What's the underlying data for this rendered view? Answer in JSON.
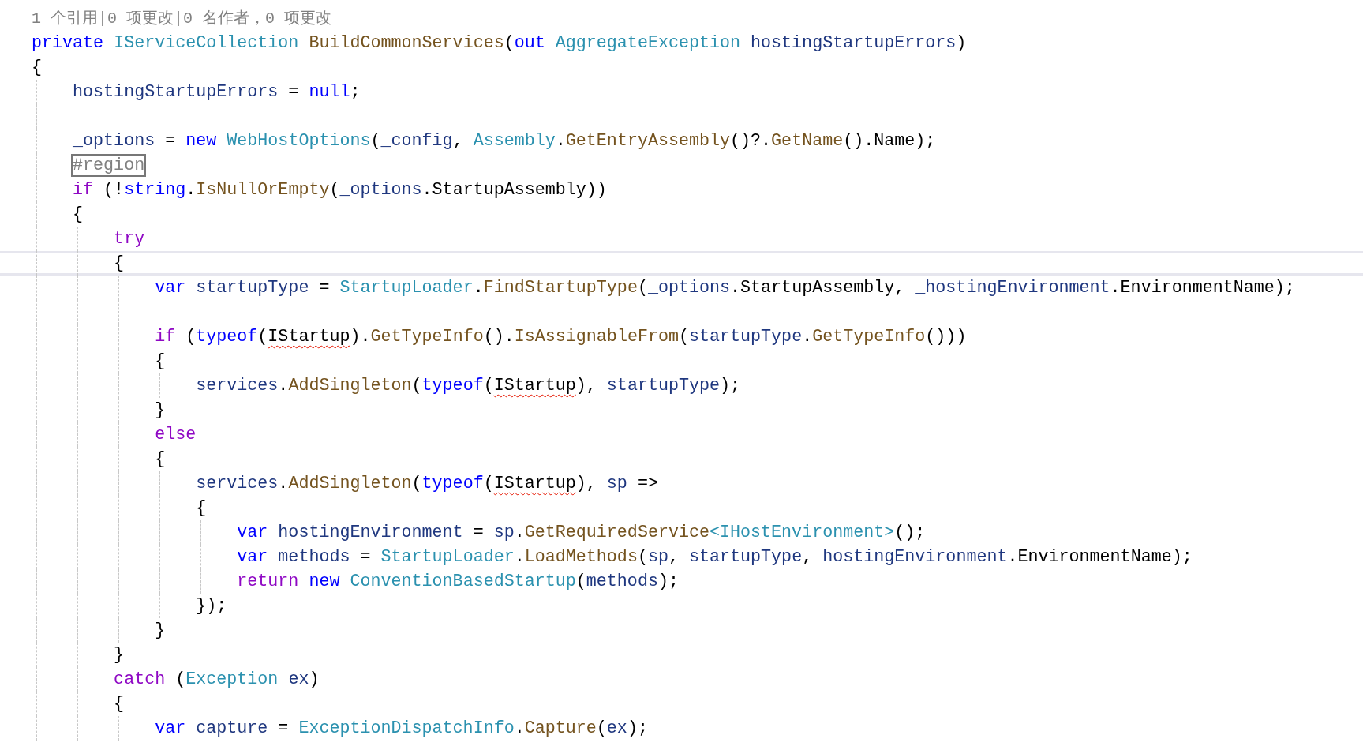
{
  "editor": {
    "lines": [
      {
        "kind": "codelens",
        "current": false,
        "tokens": [
          {
            "kind": "comment",
            "text": "1 个引用|0 项更改|0 名作者，0 项更改"
          }
        ]
      },
      {
        "kind": "code",
        "current": false,
        "tokens": [
          {
            "kind": "keyword",
            "text": "private "
          },
          {
            "kind": "type",
            "text": "IServiceCollection "
          },
          {
            "kind": "method",
            "text": "BuildCommonServices"
          },
          {
            "kind": "punct",
            "text": "("
          },
          {
            "kind": "keyword",
            "text": "out "
          },
          {
            "kind": "type",
            "text": "AggregateException "
          },
          {
            "kind": "variable",
            "text": "hostingStartupErrors"
          },
          {
            "kind": "punct",
            "text": ")"
          }
        ]
      },
      {
        "kind": "code",
        "current": false,
        "tokens": [
          {
            "kind": "punct",
            "text": "{"
          }
        ]
      },
      {
        "kind": "code",
        "current": false,
        "tokens": [
          {
            "kind": "variable",
            "text": "    hostingStartupErrors"
          },
          {
            "kind": "punct",
            "text": " = "
          },
          {
            "kind": "keyword",
            "text": "null"
          },
          {
            "kind": "punct",
            "text": ";"
          }
        ]
      },
      {
        "kind": "blank",
        "current": false
      },
      {
        "kind": "code",
        "current": false,
        "tokens": [
          {
            "kind": "variable",
            "text": "    _options"
          },
          {
            "kind": "punct",
            "text": " = "
          },
          {
            "kind": "keyword",
            "text": "new "
          },
          {
            "kind": "type",
            "text": "WebHostOptions"
          },
          {
            "kind": "punct",
            "text": "("
          },
          {
            "kind": "variable",
            "text": "_config"
          },
          {
            "kind": "punct",
            "text": ", "
          },
          {
            "kind": "type",
            "text": "Assembly"
          },
          {
            "kind": "punct",
            "text": "."
          },
          {
            "kind": "method",
            "text": "GetEntryAssembly"
          },
          {
            "kind": "punct",
            "text": "()?."
          },
          {
            "kind": "method",
            "text": "GetName"
          },
          {
            "kind": "punct",
            "text": "().Name);"
          }
        ]
      },
      {
        "kind": "code",
        "current": false,
        "tokens": [
          {
            "kind": "region",
            "text": "    #region"
          }
        ]
      },
      {
        "kind": "code",
        "current": false,
        "tokens": [
          {
            "kind": "control",
            "text": "    if "
          },
          {
            "kind": "punct",
            "text": "(!"
          },
          {
            "kind": "keyword",
            "text": "string"
          },
          {
            "kind": "punct",
            "text": "."
          },
          {
            "kind": "method",
            "text": "IsNullOrEmpty"
          },
          {
            "kind": "punct",
            "text": "("
          },
          {
            "kind": "variable",
            "text": "_options"
          },
          {
            "kind": "punct",
            "text": ".StartupAssembly))"
          }
        ]
      },
      {
        "kind": "code",
        "current": false,
        "tokens": [
          {
            "kind": "punct",
            "text": "    {"
          }
        ]
      },
      {
        "kind": "code",
        "current": false,
        "tokens": [
          {
            "kind": "control",
            "text": "        try"
          }
        ]
      },
      {
        "kind": "code",
        "current": true,
        "tokens": [
          {
            "kind": "punct",
            "text": "        {"
          }
        ]
      },
      {
        "kind": "code",
        "current": false,
        "tokens": [
          {
            "kind": "keyword",
            "text": "            var "
          },
          {
            "kind": "variable",
            "text": "startupType"
          },
          {
            "kind": "punct",
            "text": " = "
          },
          {
            "kind": "type",
            "text": "StartupLoader"
          },
          {
            "kind": "punct",
            "text": "."
          },
          {
            "kind": "method",
            "text": "FindStartupType"
          },
          {
            "kind": "punct",
            "text": "("
          },
          {
            "kind": "variable",
            "text": "_options"
          },
          {
            "kind": "punct",
            "text": ".StartupAssembly, "
          },
          {
            "kind": "variable",
            "text": "_hostingEnvironment"
          },
          {
            "kind": "punct",
            "text": ".EnvironmentName);"
          }
        ]
      },
      {
        "kind": "blank",
        "current": false
      },
      {
        "kind": "code",
        "current": false,
        "tokens": [
          {
            "kind": "control",
            "text": "            if "
          },
          {
            "kind": "punct",
            "text": "("
          },
          {
            "kind": "keyword",
            "text": "typeof"
          },
          {
            "kind": "punct",
            "text": "("
          },
          {
            "kind": "error_type",
            "text": "IStartup"
          },
          {
            "kind": "punct",
            "text": ")."
          },
          {
            "kind": "method",
            "text": "GetTypeInfo"
          },
          {
            "kind": "punct",
            "text": "()."
          },
          {
            "kind": "method",
            "text": "IsAssignableFrom"
          },
          {
            "kind": "punct",
            "text": "("
          },
          {
            "kind": "variable",
            "text": "startupType"
          },
          {
            "kind": "punct",
            "text": "."
          },
          {
            "kind": "method",
            "text": "GetTypeInfo"
          },
          {
            "kind": "punct",
            "text": "()))"
          }
        ]
      },
      {
        "kind": "code",
        "current": false,
        "tokens": [
          {
            "kind": "punct",
            "text": "            {"
          }
        ]
      },
      {
        "kind": "code",
        "current": false,
        "tokens": [
          {
            "kind": "variable",
            "text": "                services"
          },
          {
            "kind": "punct",
            "text": "."
          },
          {
            "kind": "method",
            "text": "AddSingleton"
          },
          {
            "kind": "punct",
            "text": "("
          },
          {
            "kind": "keyword",
            "text": "typeof"
          },
          {
            "kind": "punct",
            "text": "("
          },
          {
            "kind": "error_type",
            "text": "IStartup"
          },
          {
            "kind": "punct",
            "text": "), "
          },
          {
            "kind": "variable",
            "text": "startupType"
          },
          {
            "kind": "punct",
            "text": ");"
          }
        ]
      },
      {
        "kind": "code",
        "current": false,
        "tokens": [
          {
            "kind": "punct",
            "text": "            }"
          }
        ]
      },
      {
        "kind": "code",
        "current": false,
        "tokens": [
          {
            "kind": "control",
            "text": "            else"
          }
        ]
      },
      {
        "kind": "code",
        "current": false,
        "tokens": [
          {
            "kind": "punct",
            "text": "            {"
          }
        ]
      },
      {
        "kind": "code",
        "current": false,
        "tokens": [
          {
            "kind": "variable",
            "text": "                services"
          },
          {
            "kind": "punct",
            "text": "."
          },
          {
            "kind": "method",
            "text": "AddSingleton"
          },
          {
            "kind": "punct",
            "text": "("
          },
          {
            "kind": "keyword",
            "text": "typeof"
          },
          {
            "kind": "punct",
            "text": "("
          },
          {
            "kind": "error_type",
            "text": "IStartup"
          },
          {
            "kind": "punct",
            "text": "), "
          },
          {
            "kind": "variable",
            "text": "sp"
          },
          {
            "kind": "punct",
            "text": " =>"
          }
        ]
      },
      {
        "kind": "code",
        "current": false,
        "tokens": [
          {
            "kind": "punct",
            "text": "                {"
          }
        ]
      },
      {
        "kind": "code",
        "current": false,
        "tokens": [
          {
            "kind": "keyword",
            "text": "                    var "
          },
          {
            "kind": "variable",
            "text": "hostingEnvironment"
          },
          {
            "kind": "punct",
            "text": " = "
          },
          {
            "kind": "variable",
            "text": "sp"
          },
          {
            "kind": "punct",
            "text": "."
          },
          {
            "kind": "method",
            "text": "GetRequiredService"
          },
          {
            "kind": "type",
            "text": "<IHostEnvironment>"
          },
          {
            "kind": "punct",
            "text": "();"
          }
        ]
      },
      {
        "kind": "code",
        "current": false,
        "tokens": [
          {
            "kind": "keyword",
            "text": "                    var "
          },
          {
            "kind": "variable",
            "text": "methods"
          },
          {
            "kind": "punct",
            "text": " = "
          },
          {
            "kind": "type",
            "text": "StartupLoader"
          },
          {
            "kind": "punct",
            "text": "."
          },
          {
            "kind": "method",
            "text": "LoadMethods"
          },
          {
            "kind": "punct",
            "text": "("
          },
          {
            "kind": "variable",
            "text": "sp"
          },
          {
            "kind": "punct",
            "text": ", "
          },
          {
            "kind": "variable",
            "text": "startupType"
          },
          {
            "kind": "punct",
            "text": ", "
          },
          {
            "kind": "variable",
            "text": "hostingEnvironment"
          },
          {
            "kind": "punct",
            "text": ".EnvironmentName);"
          }
        ]
      },
      {
        "kind": "code",
        "current": false,
        "tokens": [
          {
            "kind": "control",
            "text": "                    return "
          },
          {
            "kind": "keyword",
            "text": "new "
          },
          {
            "kind": "type",
            "text": "ConventionBasedStartup"
          },
          {
            "kind": "punct",
            "text": "("
          },
          {
            "kind": "variable",
            "text": "methods"
          },
          {
            "kind": "punct",
            "text": ");"
          }
        ]
      },
      {
        "kind": "code",
        "current": false,
        "tokens": [
          {
            "kind": "punct",
            "text": "                });"
          }
        ]
      },
      {
        "kind": "code",
        "current": false,
        "tokens": [
          {
            "kind": "punct",
            "text": "            }"
          }
        ]
      },
      {
        "kind": "code",
        "current": false,
        "tokens": [
          {
            "kind": "punct",
            "text": "        }"
          }
        ]
      },
      {
        "kind": "code",
        "current": false,
        "tokens": [
          {
            "kind": "control",
            "text": "        catch "
          },
          {
            "kind": "punct",
            "text": "("
          },
          {
            "kind": "type",
            "text": "Exception "
          },
          {
            "kind": "variable",
            "text": "ex"
          },
          {
            "kind": "punct",
            "text": ")"
          }
        ]
      },
      {
        "kind": "code",
        "current": false,
        "tokens": [
          {
            "kind": "punct",
            "text": "        {"
          }
        ]
      },
      {
        "kind": "code",
        "current": false,
        "tokens": [
          {
            "kind": "keyword",
            "text": "            var "
          },
          {
            "kind": "variable",
            "text": "capture"
          },
          {
            "kind": "punct",
            "text": " = "
          },
          {
            "kind": "type",
            "text": "ExceptionDispatchInfo"
          },
          {
            "kind": "punct",
            "text": "."
          },
          {
            "kind": "method",
            "text": "Capture"
          },
          {
            "kind": "punct",
            "text": "("
          },
          {
            "kind": "variable",
            "text": "ex"
          },
          {
            "kind": "punct",
            "text": ");"
          }
        ]
      }
    ]
  }
}
